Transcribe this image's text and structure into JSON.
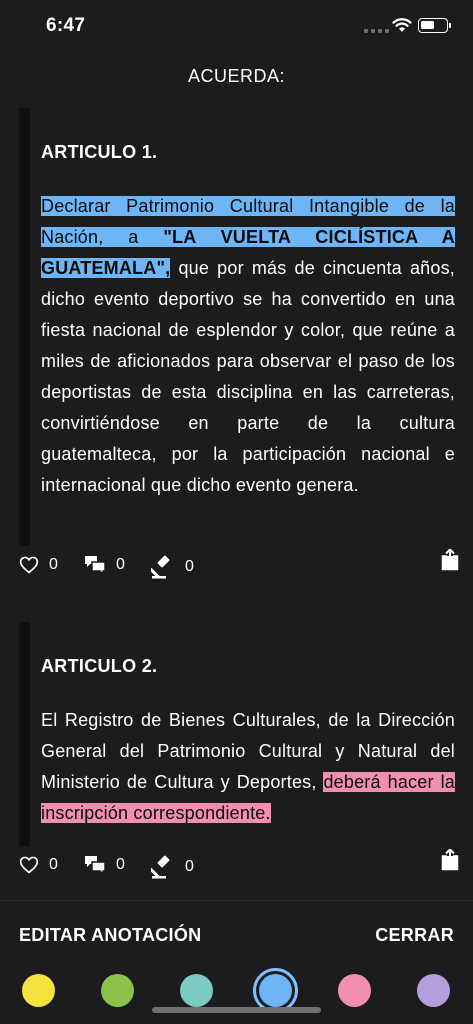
{
  "status_bar": {
    "time": "6:47"
  },
  "header": {
    "title": "ACUERDA:"
  },
  "articles": [
    {
      "heading": "ARTICULO 1.",
      "text_highlight_a": "Declarar Patrimonio Cultural Intangible de la Nación, a ",
      "text_highlight_bold": "\"LA VUELTA CICLÍSTICA A GUATEMALA\",",
      "text_rest": " que por más de cincuenta años, dicho evento deportivo se ha convertido en una fiesta nacional de esplendor y color, que reúne a miles de aficionados para observar el paso de los deportistas de esta disciplina en las carreteras, convirtiéndose en parte de la cultura guatemalteca, por la participación nacional e internacional que dicho evento genera.",
      "likes": "0",
      "comments": "0",
      "votes": "0",
      "highlight_color": "#6db5f5"
    },
    {
      "heading": "ARTICULO 2.",
      "text_plain": "El Registro de Bienes Culturales, de la Dirección General del Patrimonio Cultural y Natural del Ministerio de Cultura y Deportes, ",
      "text_highlight": "deberá hacer la inscripción correspondiente.",
      "likes": "0",
      "comments": "0",
      "votes": "0",
      "highlight_color": "#f08fb0"
    }
  ],
  "icons": {
    "like": "heart-icon",
    "comment": "comments-icon",
    "vote": "gavel-icon",
    "share": "share-icon"
  },
  "annotation_bar": {
    "edit_label": "EDITAR ANOTACIÓN",
    "close_label": "CERRAR",
    "colors": [
      "#f5e23c",
      "#8bc34a",
      "#7ccac0",
      "#6db5f5",
      "#f08fb0",
      "#b39ddb"
    ],
    "selected_color": "#6db5f5"
  }
}
